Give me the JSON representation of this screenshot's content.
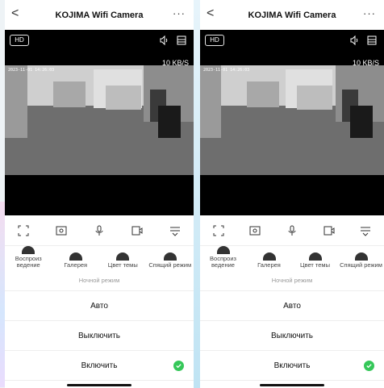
{
  "header": {
    "title": "KOJIMA Wifi Camera",
    "back_glyph": "<",
    "more_glyph": "···"
  },
  "video": {
    "quality_label": "HD",
    "left_rate": "10 KB/S",
    "right_rate": "10 KB/S",
    "timestamp": "2023-11-01 14:26:03"
  },
  "controls": [
    "fullscreen-icon",
    "snapshot-icon",
    "microphone-icon",
    "record-icon",
    "collapse-icon"
  ],
  "features": [
    {
      "label": "Воспроиз ведение"
    },
    {
      "label": "Галерея"
    },
    {
      "label": "Цвет темы"
    },
    {
      "label": "Спящий режим"
    }
  ],
  "night_mode": {
    "title": "Ночной режим",
    "options": [
      "Авто",
      "Выключить",
      "Включить"
    ],
    "selected": "Включить"
  },
  "colors": {
    "accent": "#35c759",
    "video_bg": "#000000"
  }
}
